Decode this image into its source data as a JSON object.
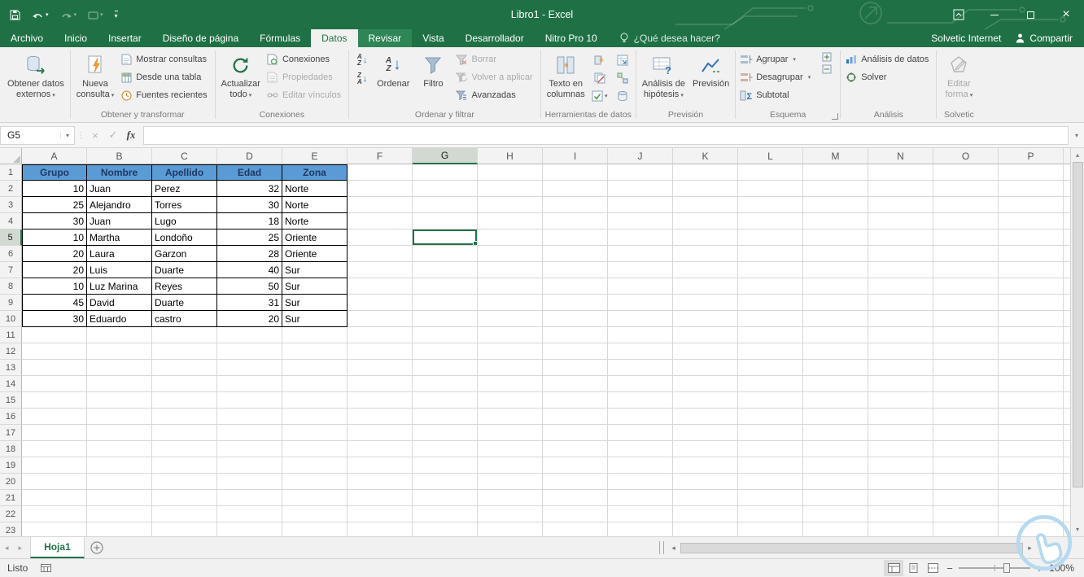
{
  "titlebar": {
    "title": "Libro1 - Excel"
  },
  "tabs": {
    "items": [
      {
        "label": "Archivo"
      },
      {
        "label": "Inicio"
      },
      {
        "label": "Insertar"
      },
      {
        "label": "Diseño de página"
      },
      {
        "label": "Fórmulas"
      },
      {
        "label": "Datos",
        "state": "active"
      },
      {
        "label": "Revisar",
        "state": "hover"
      },
      {
        "label": "Vista"
      },
      {
        "label": "Desarrollador"
      },
      {
        "label": "Nitro Pro 10"
      }
    ],
    "tell_me": "¿Qué desea hacer?",
    "account": "Solvetic Internet",
    "share": "Compartir"
  },
  "ribbon": {
    "get_external": {
      "l1": "Obtener datos",
      "l2": "externos"
    },
    "transform": {
      "label": "Obtener y transformar",
      "nueva_l1": "Nueva",
      "nueva_l2": "consulta",
      "items": [
        "Mostrar consultas",
        "Desde una tabla",
        "Fuentes recientes"
      ]
    },
    "connections": {
      "label": "Conexiones",
      "refresh_l1": "Actualizar",
      "refresh_l2": "todo",
      "items": [
        "Conexiones",
        "Propiedades",
        "Editar vínculos"
      ]
    },
    "sort_filter": {
      "label": "Ordenar y filtrar",
      "ordenar": "Ordenar",
      "filtro": "Filtro",
      "items": [
        "Borrar",
        "Volver a aplicar",
        "Avanzadas"
      ]
    },
    "data_tools": {
      "label": "Herramientas de datos",
      "text_l1": "Texto en",
      "text_l2": "columnas"
    },
    "forecast": {
      "label": "Previsión",
      "hip_l1": "Análisis de",
      "hip_l2": "hipótesis",
      "prevision": "Previsión"
    },
    "outline": {
      "label": "Esquema",
      "items": [
        "Agrupar",
        "Desagrupar",
        "Subtotal"
      ]
    },
    "analysis": {
      "label": "Análisis",
      "items": [
        "Análisis de datos",
        "Solver"
      ]
    },
    "solvetic_group": {
      "label": "Solvetic",
      "l1": "Editar",
      "l2": "forma"
    }
  },
  "formula_bar": {
    "name_box": "G5",
    "fx": "fx"
  },
  "grid": {
    "columns": [
      "A",
      "B",
      "C",
      "D",
      "E",
      "F",
      "G",
      "H",
      "I",
      "J",
      "K",
      "L",
      "M",
      "N",
      "O",
      "P"
    ],
    "row_count": 23,
    "selected_cell": {
      "col": "G",
      "row": 5
    },
    "table": {
      "headers": [
        "Grupo",
        "Nombre",
        "Apellido",
        "Edad",
        "Zona"
      ],
      "header_fill": "#5b9bd5",
      "rows": [
        [
          "10",
          "Juan",
          "Perez",
          "32",
          "Norte"
        ],
        [
          "25",
          "Alejandro",
          "Torres",
          "30",
          "Norte"
        ],
        [
          "30",
          "Juan",
          "Lugo",
          "18",
          "Norte"
        ],
        [
          "10",
          "Martha",
          "Londoño",
          "25",
          "Oriente"
        ],
        [
          "20",
          "Laura",
          "Garzon",
          "28",
          "Oriente"
        ],
        [
          "20",
          "Luis",
          "Duarte",
          "40",
          "Sur"
        ],
        [
          "10",
          "Luz Marina",
          "Reyes",
          "50",
          "Sur"
        ],
        [
          "45",
          "David",
          "Duarte",
          "31",
          "Sur"
        ],
        [
          "30",
          "Eduardo",
          "castro",
          "20",
          "Sur"
        ]
      ]
    }
  },
  "sheet_tabs": {
    "active": "Hoja1"
  },
  "status_bar": {
    "ready": "Listo",
    "zoom": "100%"
  },
  "colors": {
    "excel_green": "#217346",
    "header_blue": "#5b9bd5"
  }
}
